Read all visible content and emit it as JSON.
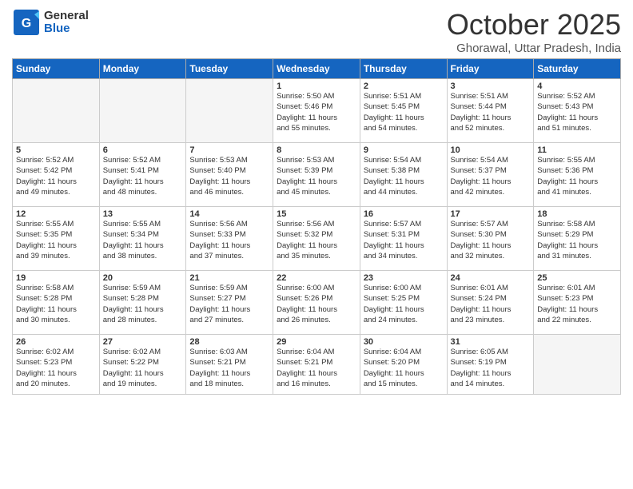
{
  "header": {
    "logo_general": "General",
    "logo_blue": "Blue",
    "month": "October 2025",
    "location": "Ghorawal, Uttar Pradesh, India"
  },
  "days_of_week": [
    "Sunday",
    "Monday",
    "Tuesday",
    "Wednesday",
    "Thursday",
    "Friday",
    "Saturday"
  ],
  "weeks": [
    [
      {
        "day": "",
        "info": ""
      },
      {
        "day": "",
        "info": ""
      },
      {
        "day": "",
        "info": ""
      },
      {
        "day": "1",
        "info": "Sunrise: 5:50 AM\nSunset: 5:46 PM\nDaylight: 11 hours\nand 55 minutes."
      },
      {
        "day": "2",
        "info": "Sunrise: 5:51 AM\nSunset: 5:45 PM\nDaylight: 11 hours\nand 54 minutes."
      },
      {
        "day": "3",
        "info": "Sunrise: 5:51 AM\nSunset: 5:44 PM\nDaylight: 11 hours\nand 52 minutes."
      },
      {
        "day": "4",
        "info": "Sunrise: 5:52 AM\nSunset: 5:43 PM\nDaylight: 11 hours\nand 51 minutes."
      }
    ],
    [
      {
        "day": "5",
        "info": "Sunrise: 5:52 AM\nSunset: 5:42 PM\nDaylight: 11 hours\nand 49 minutes."
      },
      {
        "day": "6",
        "info": "Sunrise: 5:52 AM\nSunset: 5:41 PM\nDaylight: 11 hours\nand 48 minutes."
      },
      {
        "day": "7",
        "info": "Sunrise: 5:53 AM\nSunset: 5:40 PM\nDaylight: 11 hours\nand 46 minutes."
      },
      {
        "day": "8",
        "info": "Sunrise: 5:53 AM\nSunset: 5:39 PM\nDaylight: 11 hours\nand 45 minutes."
      },
      {
        "day": "9",
        "info": "Sunrise: 5:54 AM\nSunset: 5:38 PM\nDaylight: 11 hours\nand 44 minutes."
      },
      {
        "day": "10",
        "info": "Sunrise: 5:54 AM\nSunset: 5:37 PM\nDaylight: 11 hours\nand 42 minutes."
      },
      {
        "day": "11",
        "info": "Sunrise: 5:55 AM\nSunset: 5:36 PM\nDaylight: 11 hours\nand 41 minutes."
      }
    ],
    [
      {
        "day": "12",
        "info": "Sunrise: 5:55 AM\nSunset: 5:35 PM\nDaylight: 11 hours\nand 39 minutes."
      },
      {
        "day": "13",
        "info": "Sunrise: 5:55 AM\nSunset: 5:34 PM\nDaylight: 11 hours\nand 38 minutes."
      },
      {
        "day": "14",
        "info": "Sunrise: 5:56 AM\nSunset: 5:33 PM\nDaylight: 11 hours\nand 37 minutes."
      },
      {
        "day": "15",
        "info": "Sunrise: 5:56 AM\nSunset: 5:32 PM\nDaylight: 11 hours\nand 35 minutes."
      },
      {
        "day": "16",
        "info": "Sunrise: 5:57 AM\nSunset: 5:31 PM\nDaylight: 11 hours\nand 34 minutes."
      },
      {
        "day": "17",
        "info": "Sunrise: 5:57 AM\nSunset: 5:30 PM\nDaylight: 11 hours\nand 32 minutes."
      },
      {
        "day": "18",
        "info": "Sunrise: 5:58 AM\nSunset: 5:29 PM\nDaylight: 11 hours\nand 31 minutes."
      }
    ],
    [
      {
        "day": "19",
        "info": "Sunrise: 5:58 AM\nSunset: 5:28 PM\nDaylight: 11 hours\nand 30 minutes."
      },
      {
        "day": "20",
        "info": "Sunrise: 5:59 AM\nSunset: 5:28 PM\nDaylight: 11 hours\nand 28 minutes."
      },
      {
        "day": "21",
        "info": "Sunrise: 5:59 AM\nSunset: 5:27 PM\nDaylight: 11 hours\nand 27 minutes."
      },
      {
        "day": "22",
        "info": "Sunrise: 6:00 AM\nSunset: 5:26 PM\nDaylight: 11 hours\nand 26 minutes."
      },
      {
        "day": "23",
        "info": "Sunrise: 6:00 AM\nSunset: 5:25 PM\nDaylight: 11 hours\nand 24 minutes."
      },
      {
        "day": "24",
        "info": "Sunrise: 6:01 AM\nSunset: 5:24 PM\nDaylight: 11 hours\nand 23 minutes."
      },
      {
        "day": "25",
        "info": "Sunrise: 6:01 AM\nSunset: 5:23 PM\nDaylight: 11 hours\nand 22 minutes."
      }
    ],
    [
      {
        "day": "26",
        "info": "Sunrise: 6:02 AM\nSunset: 5:23 PM\nDaylight: 11 hours\nand 20 minutes."
      },
      {
        "day": "27",
        "info": "Sunrise: 6:02 AM\nSunset: 5:22 PM\nDaylight: 11 hours\nand 19 minutes."
      },
      {
        "day": "28",
        "info": "Sunrise: 6:03 AM\nSunset: 5:21 PM\nDaylight: 11 hours\nand 18 minutes."
      },
      {
        "day": "29",
        "info": "Sunrise: 6:04 AM\nSunset: 5:21 PM\nDaylight: 11 hours\nand 16 minutes."
      },
      {
        "day": "30",
        "info": "Sunrise: 6:04 AM\nSunset: 5:20 PM\nDaylight: 11 hours\nand 15 minutes."
      },
      {
        "day": "31",
        "info": "Sunrise: 6:05 AM\nSunset: 5:19 PM\nDaylight: 11 hours\nand 14 minutes."
      },
      {
        "day": "",
        "info": ""
      }
    ]
  ]
}
